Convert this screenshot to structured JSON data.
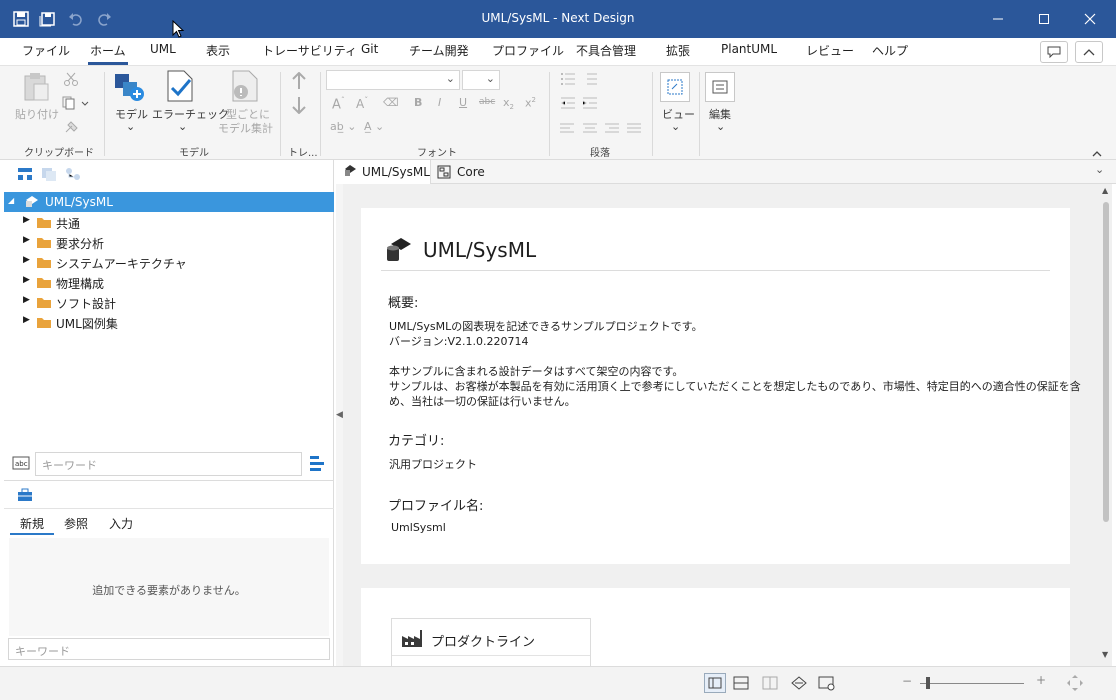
{
  "window": {
    "title": "UML/SysML - Next Design"
  },
  "menu": {
    "tabs": [
      "ファイル",
      "ホーム",
      "UML",
      "表示",
      "トレーサビリティ",
      "Git",
      "チーム開発",
      "プロファイル",
      "不具合管理",
      "拡張",
      "PlantUML",
      "レビュー",
      "ヘルプ"
    ],
    "active": "ホーム"
  },
  "ribbon": {
    "paste": "貼り付け",
    "clipboard_group": "クリップボード",
    "model_btn": "モデル",
    "error_check": "エラーチェック",
    "model_count_1": "型ごとに",
    "model_count_2": "モデル集計",
    "model_group": "モデル",
    "trace_group": "トレ...",
    "font_group": "フォント",
    "paragraph_group": "段落",
    "view_btn": "ビュー",
    "edit_btn": "編集"
  },
  "tree": {
    "root": "UML/SysML",
    "items": [
      "共通",
      "要求分析",
      "システムアーキテクチャ",
      "物理構成",
      "ソフト設計",
      "UML図例集"
    ]
  },
  "left_search": {
    "placeholder": "キーワード"
  },
  "bottom_panel": {
    "tabs": [
      "新規",
      "参照",
      "入力"
    ],
    "empty": "追加できる要素がありません。",
    "search_placeholder": "キーワード"
  },
  "doc_tabs": [
    "UML/SysML",
    "Core"
  ],
  "content": {
    "title": "UML/SysML",
    "overview_heading": "概要:",
    "overview_lines": [
      "UML/SysMLの図表現を記述できるサンプルプロジェクトです。",
      "バージョン:V2.1.0.220714",
      "",
      "本サンプルに含まれる設計データはすべて架空の内容です。",
      "サンプルは、お客様が本製品を有効に活用頂く上で参考にしていただくことを想定したものであり、市場性、特定目的への適合性の保証を含",
      "め、当社は一切の保証は行いません。"
    ],
    "category_heading": "カテゴリ:",
    "category_value": "汎用プロジェクト",
    "profile_heading": "プロファイル名:",
    "profile_value": "UmlSysml",
    "productline": "プロダクトライン"
  },
  "colors": {
    "titlebar": "#2b579a",
    "selection": "#3a96dd"
  }
}
